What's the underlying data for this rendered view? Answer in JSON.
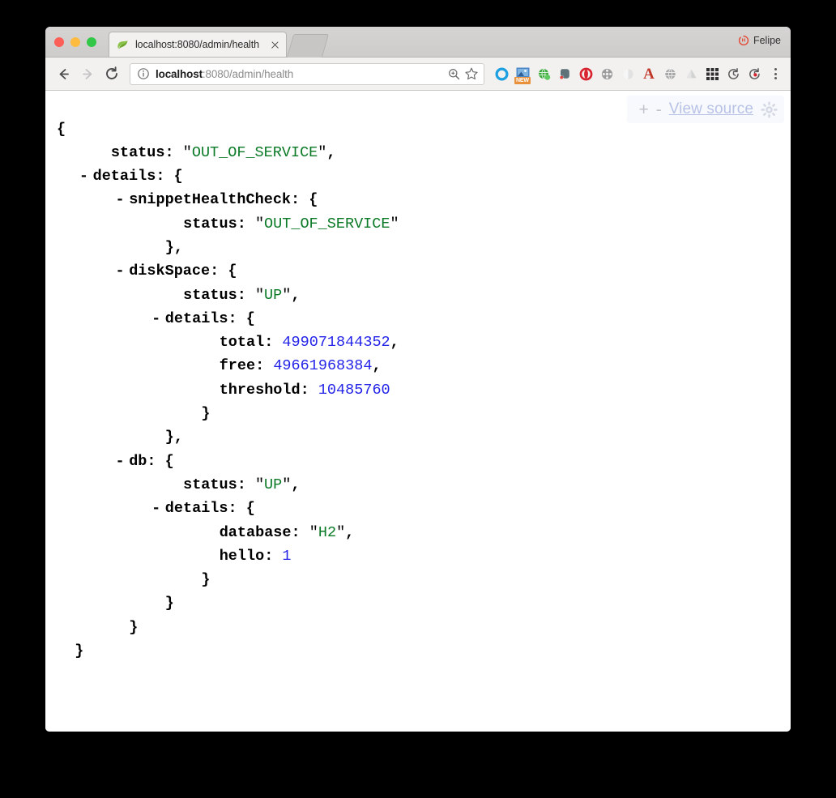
{
  "window": {
    "traffic_lights": [
      "close",
      "minimize",
      "maximize"
    ],
    "profile_name": "Felipe",
    "profile_icon": "person-warning-icon"
  },
  "tab": {
    "title": "localhost:8080/admin/health",
    "favicon": "spring-leaf-icon",
    "close_icon": "close-icon",
    "new_tab_label": ""
  },
  "toolbar": {
    "back_icon": "arrow-back-icon",
    "forward_icon": "arrow-forward-icon",
    "reload_icon": "reload-icon",
    "page_info_icon": "info-circle-icon",
    "url_host": "localhost",
    "url_rest": ":8080/admin/health",
    "url_full": "localhost:8080/admin/health",
    "zoom_icon": "zoom-magnifier-icon",
    "bookmark_icon": "star-icon",
    "menu_icon": "three-dots-vertical-icon",
    "extensions": [
      {
        "name": "pocket-ring-icon",
        "color": "#1ca0e0"
      },
      {
        "name": "screenshot-new-icon",
        "color": "#3b7fc4",
        "badge": "NEW",
        "badge_color": "#e8903a"
      },
      {
        "name": "green-globe-icon",
        "color": "#3aa93a"
      },
      {
        "name": "evernote-elephant-icon",
        "color": "#5a6b70"
      },
      {
        "name": "opera-o-icon",
        "color": "#d9232e"
      },
      {
        "name": "film-reel-icon",
        "color": "#8e8e8e"
      },
      {
        "name": "grey-circle-icon",
        "color": "#cfcfcf"
      },
      {
        "name": "red-letter-a-icon",
        "color": "#c0392b"
      },
      {
        "name": "grey-globe-icon",
        "color": "#9a9a9a"
      },
      {
        "name": "drive-triangle-icon",
        "color": "#c9c9c9"
      },
      {
        "name": "apps-grid-icon",
        "color": "#333333"
      },
      {
        "name": "refresh-clock-icon",
        "color": "#5a5a5a"
      },
      {
        "name": "refresh-clock-dot-icon",
        "color": "#5a5a5a",
        "dot_color": "#d9232e"
      }
    ]
  },
  "jsonview": {
    "expand_label": "+",
    "collapse_label": "-",
    "view_source_label": "View source",
    "gear_icon": "gear-icon"
  },
  "json_document": {
    "lines": [
      {
        "indent": 0,
        "collapser": "",
        "text": "{",
        "parts": [
          {
            "t": "punct",
            "v": "{"
          }
        ]
      },
      {
        "indent": 3,
        "collapser": "",
        "parts": [
          {
            "t": "key",
            "v": "status"
          },
          {
            "t": "punct",
            "v": ": "
          },
          {
            "t": "quote",
            "v": "\""
          },
          {
            "t": "string",
            "v": "OUT_OF_SERVICE"
          },
          {
            "t": "quote",
            "v": "\""
          },
          {
            "t": "punct",
            "v": ","
          }
        ]
      },
      {
        "indent": 2,
        "collapser": "-",
        "parts": [
          {
            "t": "key",
            "v": "details"
          },
          {
            "t": "punct",
            "v": ": {"
          }
        ]
      },
      {
        "indent": 4,
        "collapser": "-",
        "parts": [
          {
            "t": "key",
            "v": "snippetHealthCheck"
          },
          {
            "t": "punct",
            "v": ": {"
          }
        ]
      },
      {
        "indent": 7,
        "collapser": "",
        "parts": [
          {
            "t": "key",
            "v": "status"
          },
          {
            "t": "punct",
            "v": ": "
          },
          {
            "t": "quote",
            "v": "\""
          },
          {
            "t": "string",
            "v": "OUT_OF_SERVICE"
          },
          {
            "t": "quote",
            "v": "\""
          }
        ]
      },
      {
        "indent": 6,
        "collapser": "",
        "parts": [
          {
            "t": "punct",
            "v": "},"
          }
        ]
      },
      {
        "indent": 4,
        "collapser": "-",
        "parts": [
          {
            "t": "key",
            "v": "diskSpace"
          },
          {
            "t": "punct",
            "v": ": {"
          }
        ]
      },
      {
        "indent": 7,
        "collapser": "",
        "parts": [
          {
            "t": "key",
            "v": "status"
          },
          {
            "t": "punct",
            "v": ": "
          },
          {
            "t": "quote",
            "v": "\""
          },
          {
            "t": "string",
            "v": "UP"
          },
          {
            "t": "quote",
            "v": "\""
          },
          {
            "t": "punct",
            "v": ","
          }
        ]
      },
      {
        "indent": 6,
        "collapser": "-",
        "parts": [
          {
            "t": "key",
            "v": "details"
          },
          {
            "t": "punct",
            "v": ": {"
          }
        ]
      },
      {
        "indent": 9,
        "collapser": "",
        "parts": [
          {
            "t": "key",
            "v": "total"
          },
          {
            "t": "punct",
            "v": ": "
          },
          {
            "t": "num",
            "v": "499071844352"
          },
          {
            "t": "punct",
            "v": ","
          }
        ]
      },
      {
        "indent": 9,
        "collapser": "",
        "parts": [
          {
            "t": "key",
            "v": "free"
          },
          {
            "t": "punct",
            "v": ": "
          },
          {
            "t": "num",
            "v": "49661968384"
          },
          {
            "t": "punct",
            "v": ","
          }
        ]
      },
      {
        "indent": 9,
        "collapser": "",
        "parts": [
          {
            "t": "key",
            "v": "threshold"
          },
          {
            "t": "punct",
            "v": ": "
          },
          {
            "t": "num",
            "v": "10485760"
          }
        ]
      },
      {
        "indent": 8,
        "collapser": "",
        "parts": [
          {
            "t": "punct",
            "v": "}"
          }
        ]
      },
      {
        "indent": 6,
        "collapser": "",
        "parts": [
          {
            "t": "punct",
            "v": "},"
          }
        ]
      },
      {
        "indent": 4,
        "collapser": "-",
        "parts": [
          {
            "t": "key",
            "v": "db"
          },
          {
            "t": "punct",
            "v": ": {"
          }
        ]
      },
      {
        "indent": 7,
        "collapser": "",
        "parts": [
          {
            "t": "key",
            "v": "status"
          },
          {
            "t": "punct",
            "v": ": "
          },
          {
            "t": "quote",
            "v": "\""
          },
          {
            "t": "string",
            "v": "UP"
          },
          {
            "t": "quote",
            "v": "\""
          },
          {
            "t": "punct",
            "v": ","
          }
        ]
      },
      {
        "indent": 6,
        "collapser": "-",
        "parts": [
          {
            "t": "key",
            "v": "details"
          },
          {
            "t": "punct",
            "v": ": {"
          }
        ]
      },
      {
        "indent": 9,
        "collapser": "",
        "parts": [
          {
            "t": "key",
            "v": "database"
          },
          {
            "t": "punct",
            "v": ": "
          },
          {
            "t": "quote",
            "v": "\""
          },
          {
            "t": "string",
            "v": "H2"
          },
          {
            "t": "quote",
            "v": "\""
          },
          {
            "t": "punct",
            "v": ","
          }
        ]
      },
      {
        "indent": 9,
        "collapser": "",
        "parts": [
          {
            "t": "key",
            "v": "hello"
          },
          {
            "t": "punct",
            "v": ": "
          },
          {
            "t": "num",
            "v": "1"
          }
        ]
      },
      {
        "indent": 8,
        "collapser": "",
        "parts": [
          {
            "t": "punct",
            "v": "}"
          }
        ]
      },
      {
        "indent": 6,
        "collapser": "",
        "parts": [
          {
            "t": "punct",
            "v": "}"
          }
        ]
      },
      {
        "indent": 4,
        "collapser": "",
        "parts": [
          {
            "t": "punct",
            "v": "}"
          }
        ]
      },
      {
        "indent": 1,
        "collapser": "",
        "parts": [
          {
            "t": "punct",
            "v": "}"
          }
        ]
      }
    ]
  },
  "colors": {
    "string_value": "#0b7a27",
    "number_value": "#2424e8",
    "key_text": "#000000",
    "link": "#8e9dd8",
    "page_background": "#ffffff",
    "desktop_background": "#000000"
  }
}
